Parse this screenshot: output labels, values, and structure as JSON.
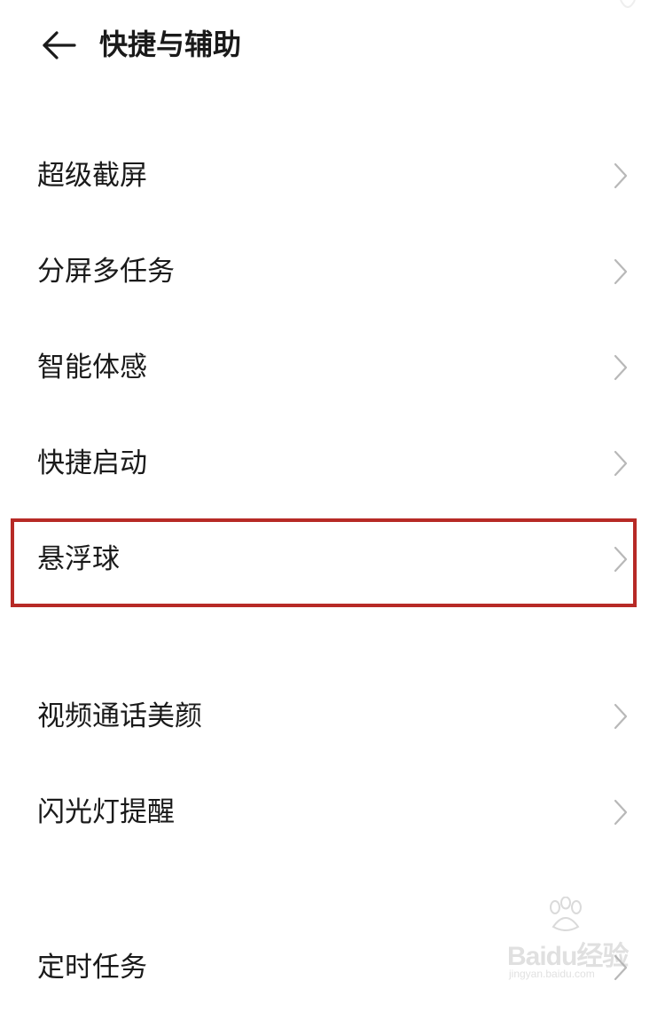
{
  "header": {
    "title": "快捷与辅助",
    "back_icon": "arrow-left-icon"
  },
  "list": [
    {
      "id": "super-screenshot",
      "label": "超级截屏"
    },
    {
      "id": "split-screen",
      "label": "分屏多任务"
    },
    {
      "id": "smart-motion",
      "label": "智能体感"
    },
    {
      "id": "quick-launch",
      "label": "快捷启动"
    },
    {
      "id": "floating-ball",
      "label": "悬浮球"
    },
    {
      "id": "video-call-beauty",
      "label": "视频通话美颜"
    },
    {
      "id": "flash-notification",
      "label": "闪光灯提醒"
    },
    {
      "id": "scheduled-tasks",
      "label": "定时任务"
    }
  ],
  "chevron_icon": "chevron-right-icon",
  "highlight": {
    "target": "floating-ball",
    "color": "#b72a26"
  },
  "watermark": {
    "logo": "Baidu经验",
    "url": "jingyan.baidu.com"
  },
  "colors": {
    "text": "#1a1a1a",
    "chevron": "#b8b8b8",
    "background": "#ffffff"
  }
}
